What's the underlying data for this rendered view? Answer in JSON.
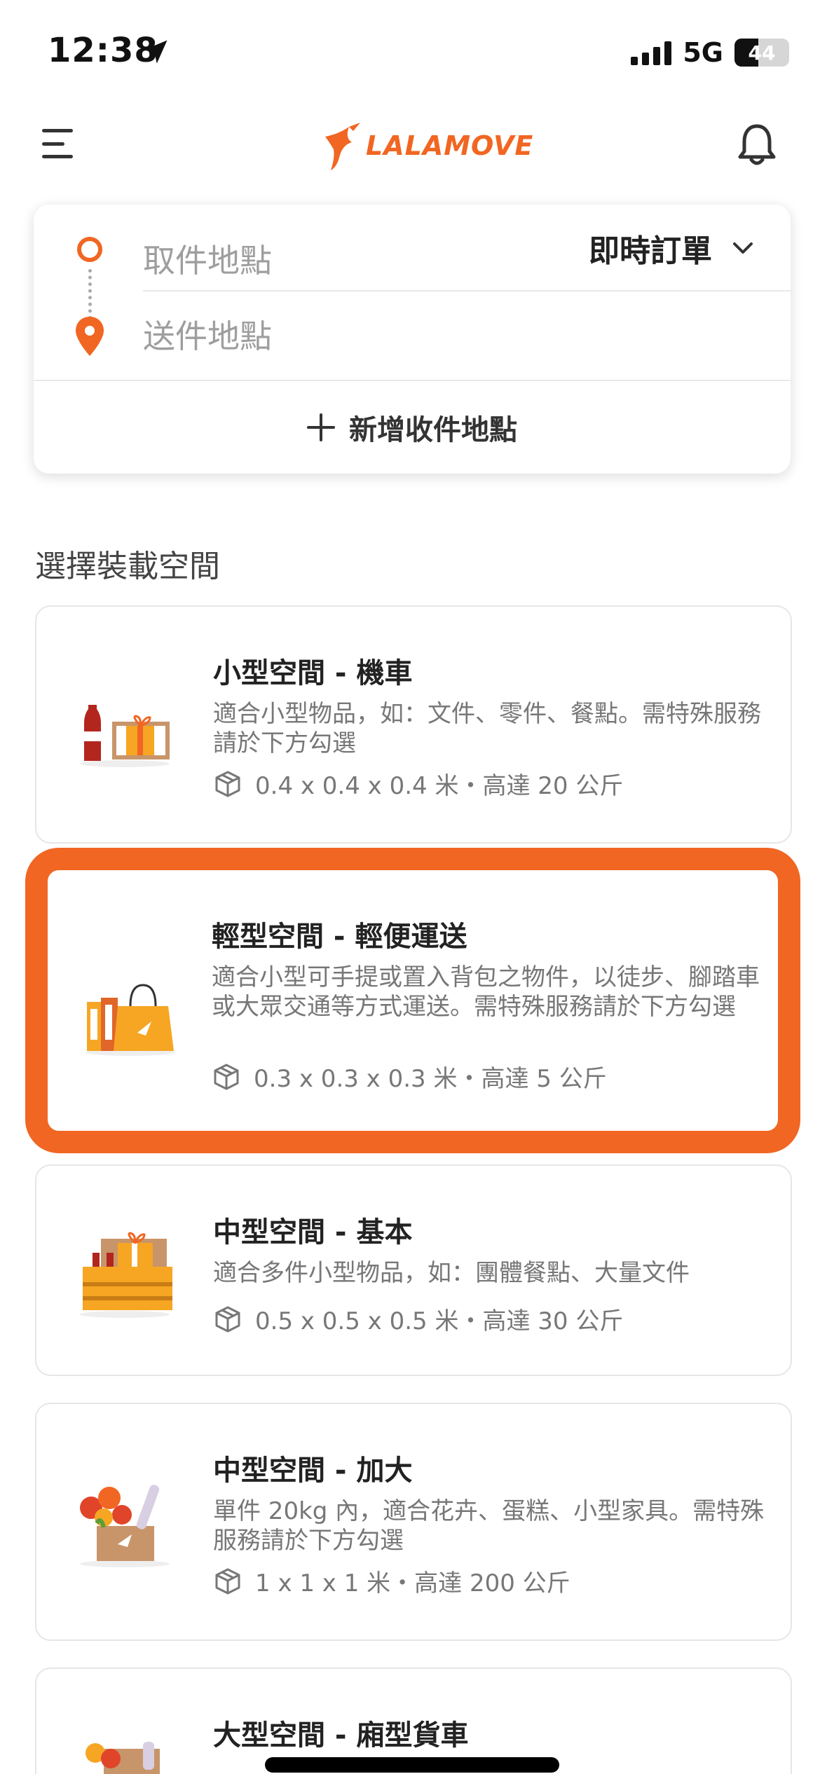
{
  "status_bar": {
    "time": "12:38",
    "network": "5G",
    "battery": "44",
    "battery_level": 0.44
  },
  "header": {
    "logo_text": "LALAMOVE",
    "brand_color": "#f16622"
  },
  "address_card": {
    "pickup_placeholder": "取件地點",
    "dropoff_placeholder": "送件地點",
    "order_type": "即時訂單",
    "add_stop_label": "新增收件地點"
  },
  "section": {
    "title": "選擇裝載空間"
  },
  "vehicles": [
    {
      "name": "小型空間 - 機車",
      "description": "適合小型物品，如：文件、零件、餐點。需特殊服務請於下方勾選",
      "spec": "0.4 x 0.4 x 0.4 米・高達 20 公斤",
      "selected": false,
      "icon": "cola-gift-icon"
    },
    {
      "name": "輕型空間 - 輕便運送",
      "description": "適合小型可手提或置入背包之物件，以徒步、腳踏車或大眾交通等方式運送。需特殊服務請於下方勾選",
      "spec": "0.3 x 0.3 x 0.3 米・高達 5 公斤",
      "selected": true,
      "icon": "binder-bag-icon"
    },
    {
      "name": "中型空間 - 基本",
      "description": "適合多件小型物品，如：團體餐點、大量文件",
      "spec": "0.5 x 0.5 x 0.5 米・高達 30 公斤",
      "selected": false,
      "icon": "crate-bottles-icon"
    },
    {
      "name": "中型空間 - 加大",
      "description": "單件 20kg 內，適合花卉、蛋糕、小型家具。需特殊服務請於下方勾選",
      "spec": "1 x 1 x 1 米・高達 200 公斤",
      "selected": false,
      "icon": "flowers-box-icon"
    },
    {
      "name": "大型空間 - 廂型貨車",
      "description": "",
      "spec": "",
      "selected": false,
      "icon": "van-cargo-icon"
    }
  ]
}
